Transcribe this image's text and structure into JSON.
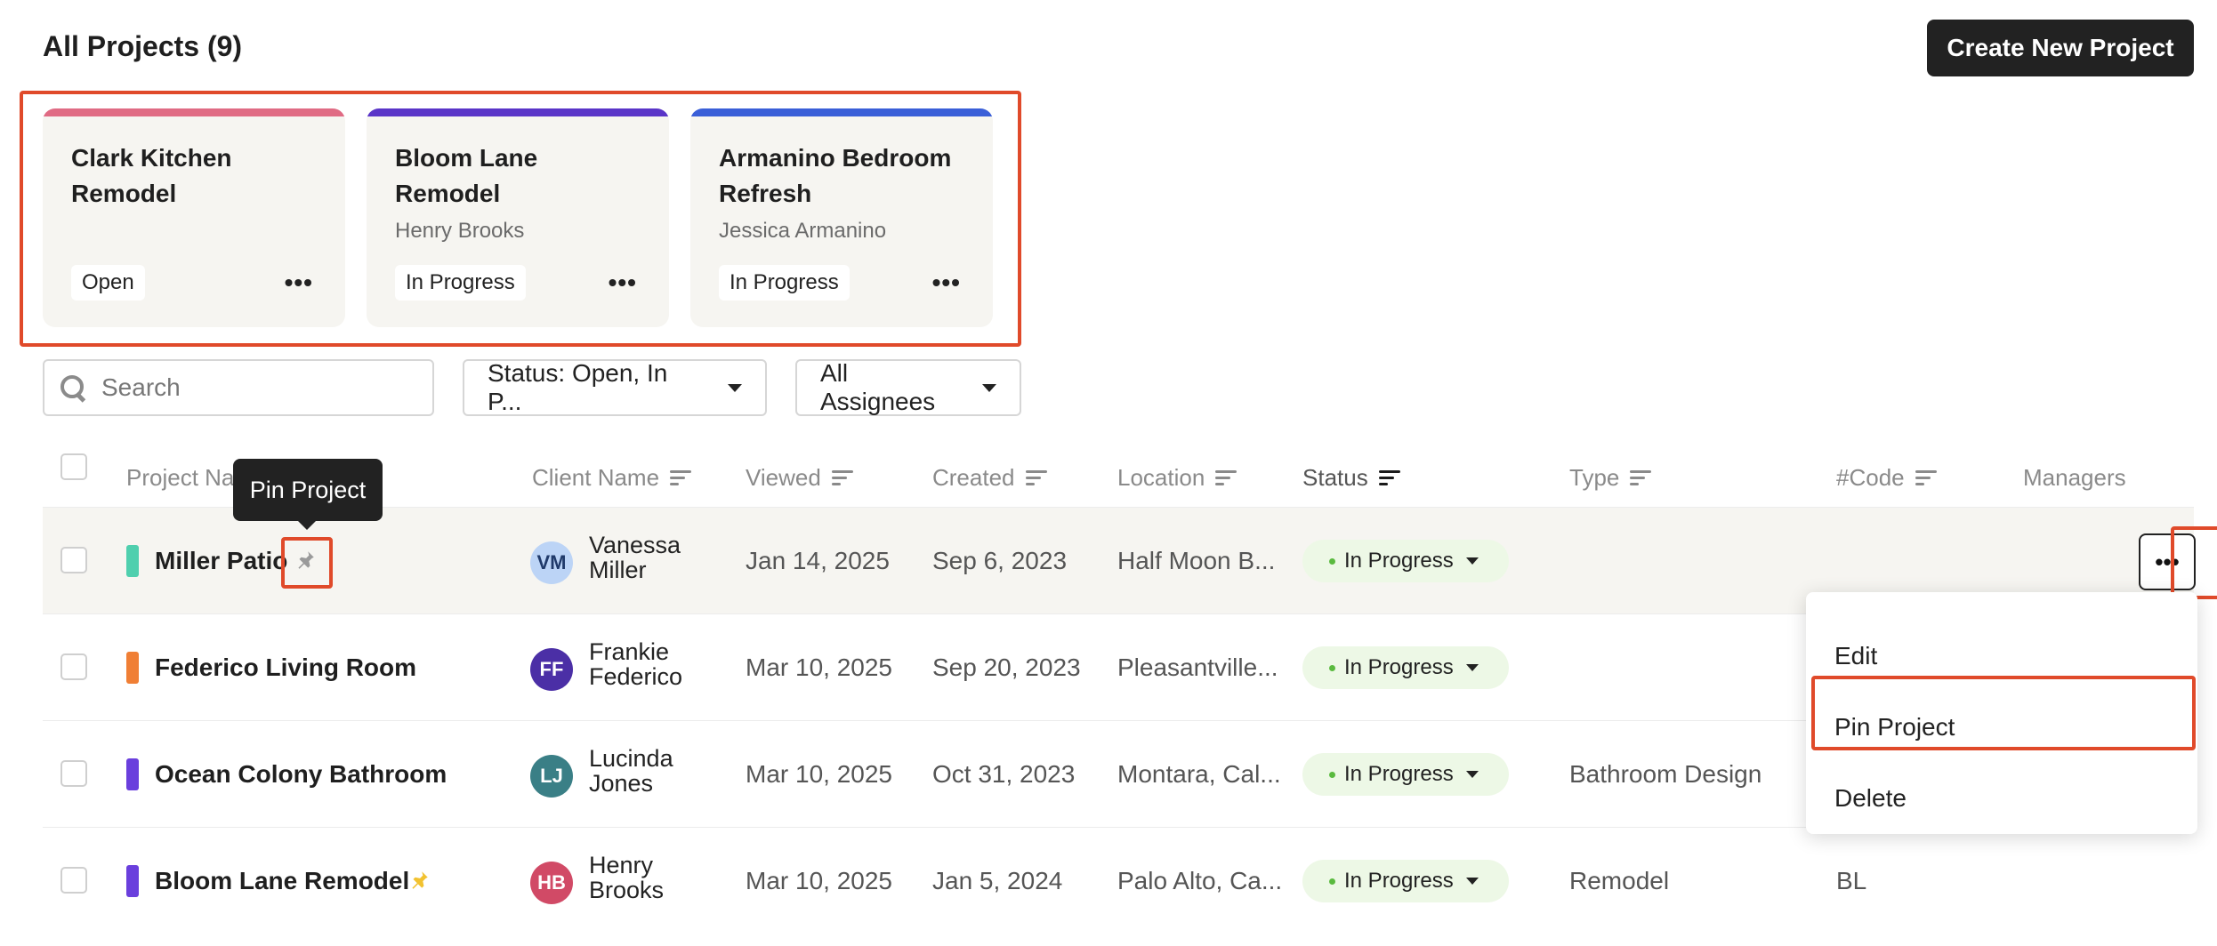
{
  "header": {
    "title": "All Projects (9)",
    "create_button": "Create New Project"
  },
  "pinned_cards": [
    {
      "title": "Clark Kitchen Remodel",
      "client": "",
      "status": "Open",
      "bar_color": "#e06b84"
    },
    {
      "title": "Bloom Lane Remodel",
      "client": "Henry Brooks",
      "status": "In Progress",
      "bar_color": "#5a35c8"
    },
    {
      "title": "Armanino Bedroom Refresh",
      "client": "Jessica Armanino",
      "status": "In Progress",
      "bar_color": "#3a5fd8"
    }
  ],
  "card_more_label": "•••",
  "filters": {
    "search_placeholder": "Search",
    "status_filter": "Status: Open, In P...",
    "assignee_filter": "All Assignees"
  },
  "columns": {
    "project_name": "Project Na",
    "client_name": "Client Name",
    "viewed": "Viewed",
    "created": "Created",
    "location": "Location",
    "status": "Status",
    "type": "Type",
    "code": "#Code",
    "managers": "Managers"
  },
  "rows": [
    {
      "name": "Miller Patio",
      "color": "#4fcfae",
      "initials": "VM",
      "avatar_bg": "#bcd4f6",
      "avatar_fg": "#203a6a",
      "client_first": "Vanessa",
      "client_last": "Miller",
      "viewed": "Jan 14, 2025",
      "created": "Sep 6, 2023",
      "location": "Half Moon B...",
      "status": "In Progress",
      "type": "",
      "code": "",
      "pinned": false
    },
    {
      "name": "Federico Living Room",
      "color": "#f07f35",
      "initials": "FF",
      "avatar_bg": "#4b2fa6",
      "avatar_fg": "#ffffff",
      "client_first": "Frankie",
      "client_last": "Federico",
      "viewed": "Mar 10, 2025",
      "created": "Sep 20, 2023",
      "location": "Pleasantville...",
      "status": "In Progress",
      "type": "",
      "code": "",
      "pinned": false
    },
    {
      "name": "Ocean Colony Bathroom",
      "color": "#6a3fdd",
      "initials": "LJ",
      "avatar_bg": "#3a7f86",
      "avatar_fg": "#ffffff",
      "client_first": "Lucinda",
      "client_last": "Jones",
      "viewed": "Mar 10, 2025",
      "created": "Oct 31, 2023",
      "location": "Montara, Cal...",
      "status": "In Progress",
      "type": "Bathroom Design",
      "code": "",
      "pinned": false
    },
    {
      "name": "Bloom Lane Remodel",
      "color": "#6a3fdd",
      "initials": "HB",
      "avatar_bg": "#d14a66",
      "avatar_fg": "#ffffff",
      "client_first": "Henry",
      "client_last": "Brooks",
      "viewed": "Mar 10, 2025",
      "created": "Jan 5, 2024",
      "location": "Palo Alto, Ca...",
      "status": "In Progress",
      "type": "Remodel",
      "code": "BL",
      "pinned": true
    }
  ],
  "tooltip": "Pin Project",
  "row_more_label": "•••",
  "context_menu": [
    "Edit",
    "Pin Project",
    "Delete"
  ],
  "colors": {
    "highlight": "#e04a2a",
    "pin_active": "#f2c230",
    "pin_inactive": "#9a9a9a"
  }
}
